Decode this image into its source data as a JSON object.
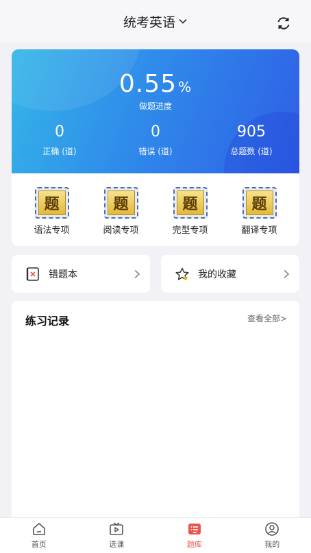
{
  "header": {
    "title": "统考英语",
    "refresh_icon": "refresh-icon",
    "dropdown_icon": "chevron-down-icon"
  },
  "progress": {
    "value": "0.55",
    "unit": "%",
    "label": "做题进度"
  },
  "stats": [
    {
      "value": "0",
      "label": "正确 (道)"
    },
    {
      "value": "0",
      "label": "错误 (道)"
    },
    {
      "value": "905",
      "label": "总题数 (道)"
    }
  ],
  "topic_badge_char": "题",
  "topics": [
    {
      "label": "语法专项"
    },
    {
      "label": "阅读专项"
    },
    {
      "label": "完型专项"
    },
    {
      "label": "翻译专项"
    }
  ],
  "quick_links": {
    "wrong_book": {
      "label": "错题本",
      "icon": "wrong-book-icon"
    },
    "favorites": {
      "label": "我的收藏",
      "icon": "star-icon"
    }
  },
  "records": {
    "title": "练习记录",
    "more": "查看全部>"
  },
  "nav": [
    {
      "label": "首页",
      "icon": "home-icon",
      "active": false
    },
    {
      "label": "选课",
      "icon": "tv-play-icon",
      "active": false
    },
    {
      "label": "题库",
      "icon": "question-bank-icon",
      "active": true
    },
    {
      "label": "我的",
      "icon": "user-icon",
      "active": false
    }
  ],
  "colors": {
    "card_gradient_start": "#35b6e8",
    "card_gradient_end": "#2f5ee6",
    "nav_active": "#e8554e",
    "background": "#f2f2f6"
  }
}
